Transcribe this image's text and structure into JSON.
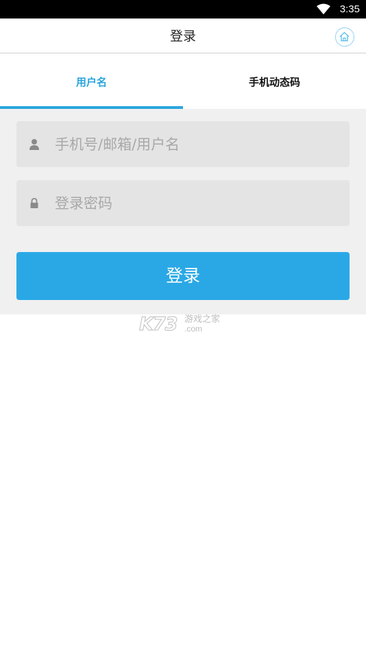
{
  "status_bar": {
    "time": "3:35",
    "wifi_icon": "wifi-icon"
  },
  "header": {
    "title": "登录",
    "home_icon": "home-icon"
  },
  "tabs": [
    {
      "label": "用户名",
      "active": true
    },
    {
      "label": "手机动态码",
      "active": false
    }
  ],
  "form": {
    "username": {
      "placeholder": "手机号/邮箱/用户名",
      "value": "",
      "icon": "user-icon"
    },
    "password": {
      "placeholder": "登录密码",
      "value": "",
      "icon": "lock-icon"
    },
    "submit_label": "登录"
  },
  "watermark": {
    "brand": "K73",
    "tagline": "游戏之家",
    "domain": ".com"
  },
  "colors": {
    "accent": "#2aa5dc",
    "button": "#2aa8e6",
    "field_bg": "#e4e4e4",
    "panel_bg": "#f0f0f0",
    "placeholder": "#a8a8a8"
  }
}
